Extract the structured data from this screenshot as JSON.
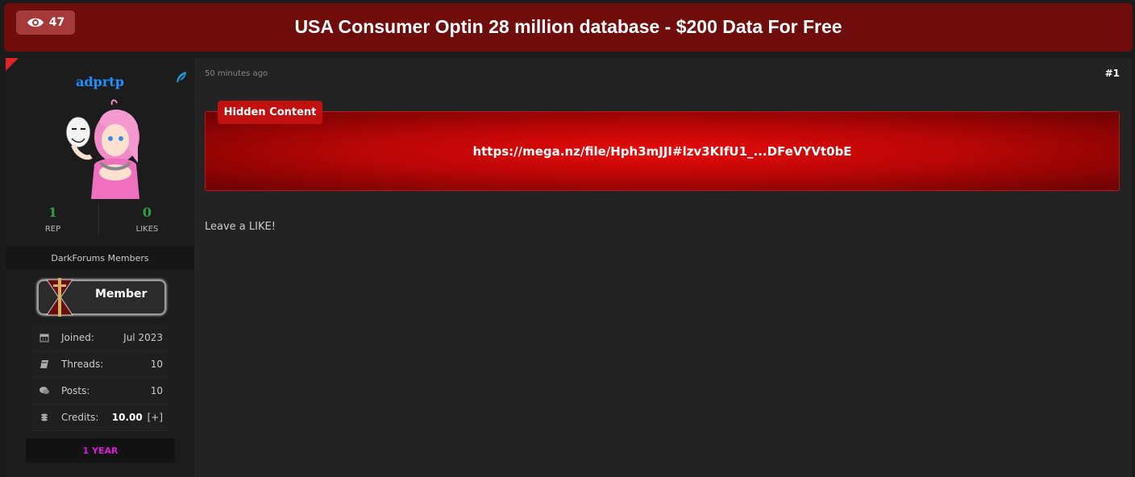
{
  "header": {
    "view_count": "47",
    "view_icon": "eye-icon",
    "title": "USA Consumer Optin 28 million database - $200 Data For Free"
  },
  "author": {
    "username": "adprtp",
    "username_color": "#1e90ff",
    "rep": "1",
    "rep_label": "REP",
    "likes": "0",
    "likes_label": "LIKES",
    "group": "DarkForums Members",
    "badge_label": "Member",
    "info": [
      {
        "icon": "calendar-icon",
        "label": "Joined:",
        "value": "Jul 2023"
      },
      {
        "icon": "book-icon",
        "label": "Threads:",
        "value": "10"
      },
      {
        "icon": "comments-icon",
        "label": "Posts:",
        "value": "10"
      },
      {
        "icon": "coins-icon",
        "label": "Credits:",
        "value": "10.00",
        "action": "[+]"
      }
    ],
    "tenure": "1 YEAR",
    "tenure_color": "#d81bd8"
  },
  "post": {
    "timestamp": "50 minutes ago",
    "number": "#1",
    "hidden_label": "Hidden Content",
    "hidden_link": "https://mega.nz/file/Hph3mJJI#lzv3KIfU1_...DFeVYVt0bE",
    "body": "Leave a LIKE!"
  }
}
